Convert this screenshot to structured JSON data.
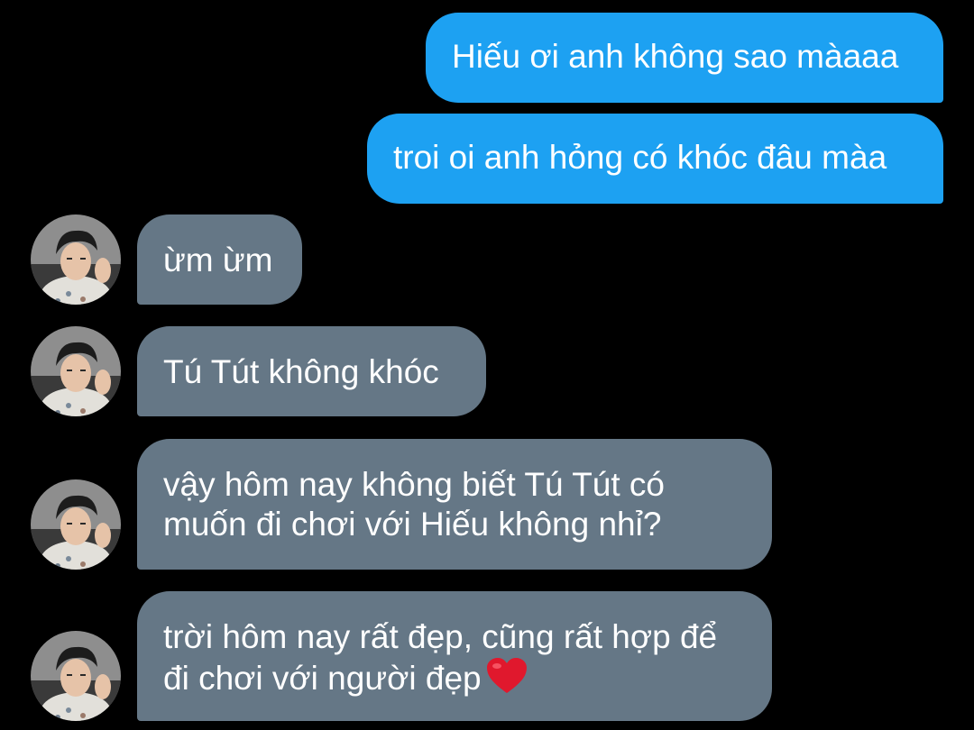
{
  "messages": [
    {
      "direction": "sent",
      "text": "Hiếu ơi anh không sao màaaa"
    },
    {
      "direction": "sent",
      "text": "troi oi anh hỏng có khóc đâu màa"
    },
    {
      "direction": "received",
      "text": "ừm ừm",
      "avatar": "profile-photo"
    },
    {
      "direction": "received",
      "text": "Tú Tút không khóc",
      "avatar": "profile-photo"
    },
    {
      "direction": "received",
      "lines": [
        "vậy hôm nay không biết Tú Tút có",
        "muốn đi chơi với Hiếu không nhỉ?"
      ],
      "avatar": "profile-photo"
    },
    {
      "direction": "received",
      "lines": [
        "trời hôm nay rất đẹp, cũng rất hợp để",
        "đi chơi với người đẹp"
      ],
      "trailing_emoji": "red-heart-icon",
      "avatar": "profile-photo"
    }
  ],
  "colors": {
    "background": "#000000",
    "sent_bubble": "#1da1f2",
    "received_bubble": "#657786",
    "text": "#ffffff",
    "heart": "#e0182d"
  }
}
